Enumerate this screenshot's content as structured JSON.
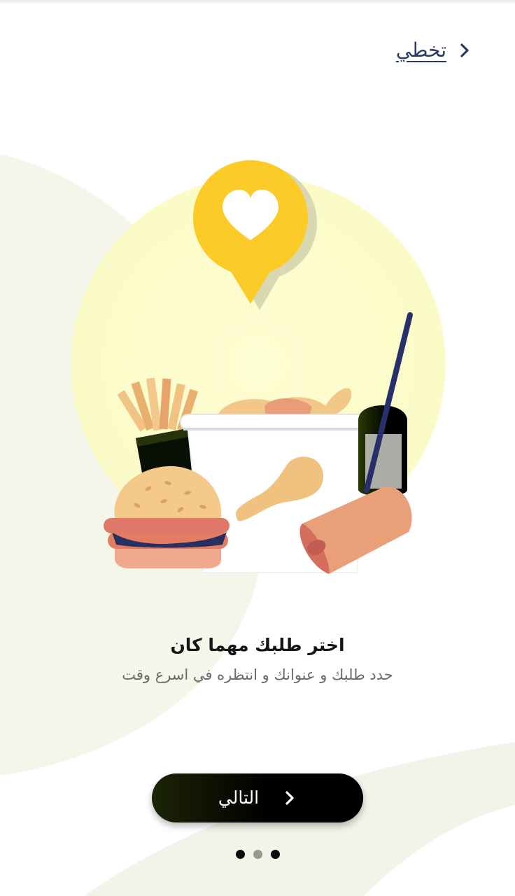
{
  "header": {
    "skip_label": "تخطي",
    "skip_icon": "chevron-right-icon"
  },
  "onboarding": {
    "title": "اختر طلبك مهما كان",
    "subtitle": "حدد طلبك و عنوانك و انتظره في اسرع وقت",
    "illustration_icons": [
      "heart-pin-icon",
      "fries-icon",
      "burger-icon",
      "chicken-bucket-icon",
      "drink-cup-icon",
      "wrap-icon"
    ]
  },
  "footer": {
    "next_label": "التالي",
    "next_icon": "chevron-right-icon",
    "page_count": 3,
    "active_page": 2
  },
  "colors": {
    "accent_yellow": "#FDCB27",
    "button_dark": "#000000",
    "link_navy": "#2C3B63",
    "circle_pale_yellow": "#FCFCCF",
    "bg_wash": "#F5F6EA"
  }
}
